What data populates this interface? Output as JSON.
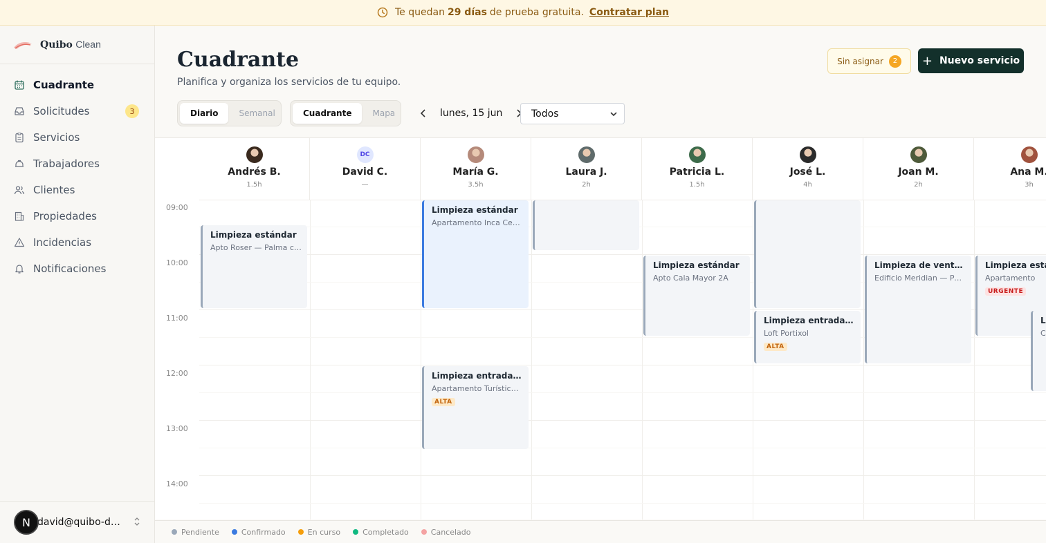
{
  "banner": {
    "pre": "Te quedan",
    "days": "29 días",
    "post": "de prueba gratuita.",
    "link": "Contratar plan"
  },
  "brand": {
    "name_bold": "Quibo",
    "name_light": "Clean"
  },
  "sidebar": {
    "items": [
      {
        "label": "Cuadrante",
        "icon": "calendar-icon"
      },
      {
        "label": "Solicitudes",
        "icon": "inbox-icon",
        "count": "3"
      },
      {
        "label": "Servicios",
        "icon": "clipboard-icon"
      },
      {
        "label": "Trabajadores",
        "icon": "hardhat-icon"
      },
      {
        "label": "Clientes",
        "icon": "users-icon"
      },
      {
        "label": "Propiedades",
        "icon": "building-icon"
      },
      {
        "label": "Incidencias",
        "icon": "alert-triangle-icon"
      },
      {
        "label": "Notificaciones",
        "icon": "bell-icon"
      }
    ],
    "user": {
      "avatar_letter": "N",
      "email": "david@quibo-demo"
    }
  },
  "header": {
    "title": "Cuadrante",
    "subtitle": "Planifica y organiza los servicios de tu equipo.",
    "unassigned_label": "Sin asignar",
    "unassigned_count": "2",
    "new_label": "Nuevo servicio"
  },
  "controls": {
    "view_daily": "Diario",
    "view_weekly": "Semanal",
    "mode_grid": "Cuadrante",
    "mode_map": "Mapa",
    "date": "lunes, 15 jun",
    "filter": "Todos"
  },
  "hours": [
    "09:00",
    "10:00",
    "11:00",
    "12:00",
    "13:00",
    "14:00"
  ],
  "workers": [
    {
      "name": "Andrés B.",
      "hours": "1.5h",
      "avatar": "photo",
      "color": "#3a2a1e"
    },
    {
      "name": "David C.",
      "hours": "—",
      "avatar": "initials",
      "initials": "DC"
    },
    {
      "name": "María G.",
      "hours": "3.5h",
      "avatar": "photo",
      "color": "#b58a7a"
    },
    {
      "name": "Laura J.",
      "hours": "2h",
      "avatar": "photo",
      "color": "#5f6b6b"
    },
    {
      "name": "Patricia L.",
      "hours": "1.5h",
      "avatar": "photo",
      "color": "#3d6b4a"
    },
    {
      "name": "José L.",
      "hours": "4h",
      "avatar": "photo",
      "color": "#2b2b2b"
    },
    {
      "name": "Joan M.",
      "hours": "2h",
      "avatar": "photo",
      "color": "#4e5a3a"
    },
    {
      "name": "Ana M.",
      "hours": "3h",
      "avatar": "photo",
      "color": "#a0523d"
    }
  ],
  "events": [
    {
      "col": 0,
      "start": 9.45,
      "end": 10.95,
      "title": "Limpieza estándar",
      "sub": "Apto Roser — Palma centro",
      "status": "pendiente"
    },
    {
      "col": 2,
      "start": 9.0,
      "end": 10.95,
      "title": "Limpieza estándar",
      "sub": "Apartamento Inca Centro",
      "status": "confirmado"
    },
    {
      "col": 2,
      "start": 12.0,
      "end": 13.5,
      "title": "Limpieza entrada/salida",
      "sub": "Apartamento Turístico Llevant",
      "tag": "ALTA",
      "status": "pendiente"
    },
    {
      "col": 3,
      "start": 9.0,
      "end": 9.9,
      "title": "",
      "sub": "",
      "status": "pendiente"
    },
    {
      "col": 4,
      "start": 10.0,
      "end": 11.45,
      "title": "Limpieza estándar",
      "sub": "Apto Cala Mayor 2A",
      "status": "pendiente"
    },
    {
      "col": 5,
      "start": 9.0,
      "end": 10.95,
      "title": "",
      "sub": "",
      "status": "pendiente"
    },
    {
      "col": 5,
      "start": 11.0,
      "end": 11.95,
      "title": "Limpieza entrada/salida",
      "sub": "Loft Portixol",
      "tag": "ALTA",
      "status": "pendiente"
    },
    {
      "col": 6,
      "start": 10.0,
      "end": 11.95,
      "title": "Limpieza de ventanas",
      "sub": "Edificio Meridian — Portals",
      "status": "pendiente"
    },
    {
      "col": 7,
      "start": 10.0,
      "end": 11.45,
      "title": "Limpieza estándar",
      "sub": "Apartamento",
      "tag": "URGENTE",
      "status": "pendiente"
    },
    {
      "col": 7.5,
      "start": 11.0,
      "end": 12.45,
      "title": "Limpieza",
      "sub": "Casa",
      "status": "pendiente"
    }
  ],
  "legend": [
    {
      "label": "Pendiente",
      "color": "#9aa8b9"
    },
    {
      "label": "Confirmado",
      "color": "#3b7be0"
    },
    {
      "label": "En curso",
      "color": "#f59e0b"
    },
    {
      "label": "Completado",
      "color": "#10b981"
    },
    {
      "label": "Cancelado",
      "color": "#f4a3a3"
    }
  ]
}
